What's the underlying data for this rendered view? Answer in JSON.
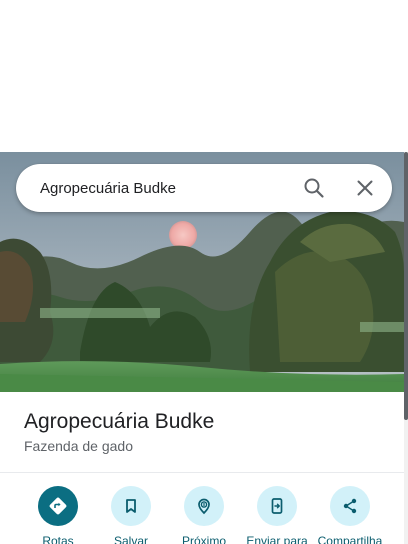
{
  "search": {
    "value": "Agropecuária Budke",
    "search_icon": "search-icon",
    "close_icon": "close-icon"
  },
  "place": {
    "name": "Agropecuária Budke",
    "category": "Fazenda de gado"
  },
  "actions": [
    {
      "label": "Rotas",
      "icon": "directions-icon"
    },
    {
      "label": "Salvar",
      "icon": "bookmark-icon"
    },
    {
      "label": "Próximo",
      "icon": "nearby-icon"
    },
    {
      "label": "Enviar para",
      "icon": "send-to-phone-icon"
    },
    {
      "label": "Compartilha",
      "icon": "share-icon"
    }
  ],
  "colors": {
    "primary_action": "#0b6e82",
    "action_bg": "#d2f1f9",
    "action_label": "#0b5d6e"
  }
}
